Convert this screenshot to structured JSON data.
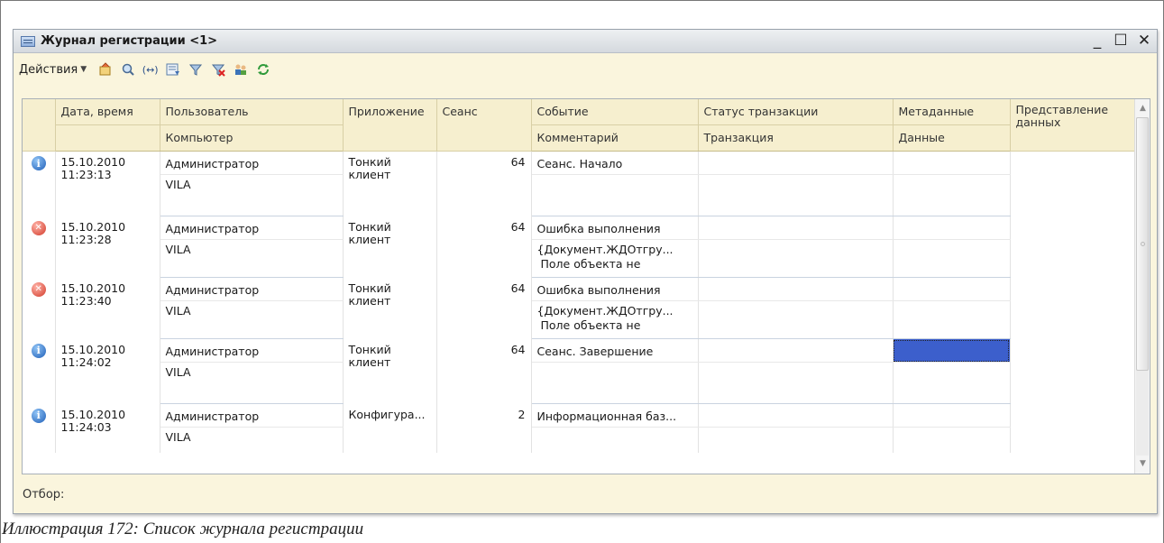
{
  "window": {
    "title": "Журнал регистрации <1>",
    "controls": {
      "minimize": "_",
      "maximize": "☐",
      "close": "✕"
    }
  },
  "toolbar": {
    "actions_label": "Действия",
    "icons": [
      "properties-icon",
      "find-icon",
      "goto-icon",
      "filter-settings-icon",
      "filter-icon",
      "clear-filter-icon",
      "users-icon",
      "refresh-icon"
    ]
  },
  "table": {
    "headers_top": [
      "Дата, время",
      "Пользователь",
      "Приложение",
      "Сеанс",
      "Событие",
      "Статус транзакции",
      "Метаданные",
      "Представление данных"
    ],
    "headers_bottom": [
      "",
      "Компьютер",
      "",
      "",
      "Комментарий",
      "Транзакция",
      "Данные",
      ""
    ],
    "rows": [
      {
        "status": "info",
        "date": "15.10.2010",
        "time": "11:23:13",
        "user": "Администратор",
        "computer": "VILA",
        "app1": "Тонкий",
        "app2": "клиент",
        "session": "64",
        "event": "Сеанс. Начало",
        "comment1": "",
        "comment2": ""
      },
      {
        "status": "error",
        "date": "15.10.2010",
        "time": "11:23:28",
        "user": "Администратор",
        "computer": "VILA",
        "app1": "Тонкий",
        "app2": "клиент",
        "session": "64",
        "event": "Ошибка выполнения",
        "comment1": "{Документ.ЖДОтгру...",
        "comment2": "Поле объекта не"
      },
      {
        "status": "error",
        "date": "15.10.2010",
        "time": "11:23:40",
        "user": "Администратор",
        "computer": "VILA",
        "app1": "Тонкий",
        "app2": "клиент",
        "session": "64",
        "event": "Ошибка выполнения",
        "comment1": "{Документ.ЖДОтгру...",
        "comment2": "Поле объекта не"
      },
      {
        "status": "info",
        "date": "15.10.2010",
        "time": "11:24:02",
        "user": "Администратор",
        "computer": "VILA",
        "app1": "Тонкий",
        "app2": "клиент",
        "session": "64",
        "event": "Сеанс. Завершение",
        "comment1": "",
        "comment2": ""
      },
      {
        "status": "info",
        "date": "15.10.2010",
        "time": "11:24:03",
        "user": "Администратор",
        "computer": "VILA",
        "app1": "Конфигура...",
        "app2": "",
        "session": "2",
        "event": "Информационная баз...",
        "comment1": "",
        "comment2": ""
      }
    ]
  },
  "filter": {
    "label": "Отбор:"
  },
  "caption": "Иллюстрация 172: Список журнала регистрации",
  "colors": {
    "window_bg": "#faf5dd",
    "header_bg": "#f6efcf",
    "selection": "#3c5fcc"
  }
}
